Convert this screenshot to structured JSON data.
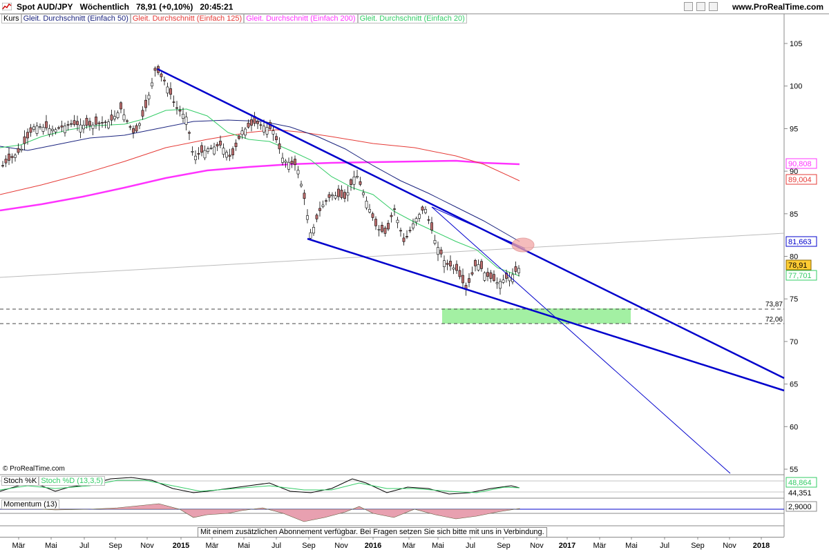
{
  "header": {
    "instrument": "Spot AUD/JPY",
    "interval": "Wöchentlich",
    "price_change": "78,91 (+0,10%)",
    "time": "20:45:21",
    "brand": "www.ProRealTime.com"
  },
  "legend": {
    "price": "Kurs",
    "ma50": "Gleit. Durchschnitt (Einfach 50)",
    "ma125": "Gleit. Durchschnitt (Einfach 125)",
    "ma200": "Gleit. Durchschnitt (Einfach 200)",
    "ma20": "Gleit. Durchschnitt (Einfach 20)"
  },
  "colors": {
    "ma50": "#1a237e",
    "ma125": "#e53935",
    "ma200": "#ff33ff",
    "ma20": "#33cc66",
    "trend": "#0000cc",
    "zone": "#99ee99"
  },
  "copyright": "© ProRealTime.com",
  "price_axis": {
    "ticks": [
      "105",
      "100",
      "95",
      "90",
      "85",
      "80",
      "75",
      "70",
      "65",
      "60",
      "55"
    ],
    "badges": {
      "ma200": "90,808",
      "ma125": "89,004",
      "line": "81,663",
      "last": "78,91",
      "ma20": "77,701"
    },
    "levels": {
      "upper": "73,87",
      "lower": "72,06"
    }
  },
  "stoch": {
    "label": "Stoch %K",
    "label_d": "Stoch %D (13,3,5)",
    "value_d": "48,864",
    "value_k": "44,351"
  },
  "momentum": {
    "label": "Momentum (13)",
    "value": "2,9000"
  },
  "x_axis": [
    "Mär",
    "Mai",
    "Jul",
    "Sep",
    "Nov",
    "2015",
    "Mär",
    "Mai",
    "Jul",
    "Sep",
    "Nov",
    "2016",
    "Mär",
    "Mai",
    "Jul",
    "Sep",
    "Nov",
    "2017",
    "Mär",
    "Mai",
    "Jul",
    "Sep",
    "Nov",
    "2018"
  ],
  "notice": "Mit einem zusätzlichen Abonnement verfügbar. Bei Fragen setzen Sie sich bitte mit uns in Verbindung."
}
